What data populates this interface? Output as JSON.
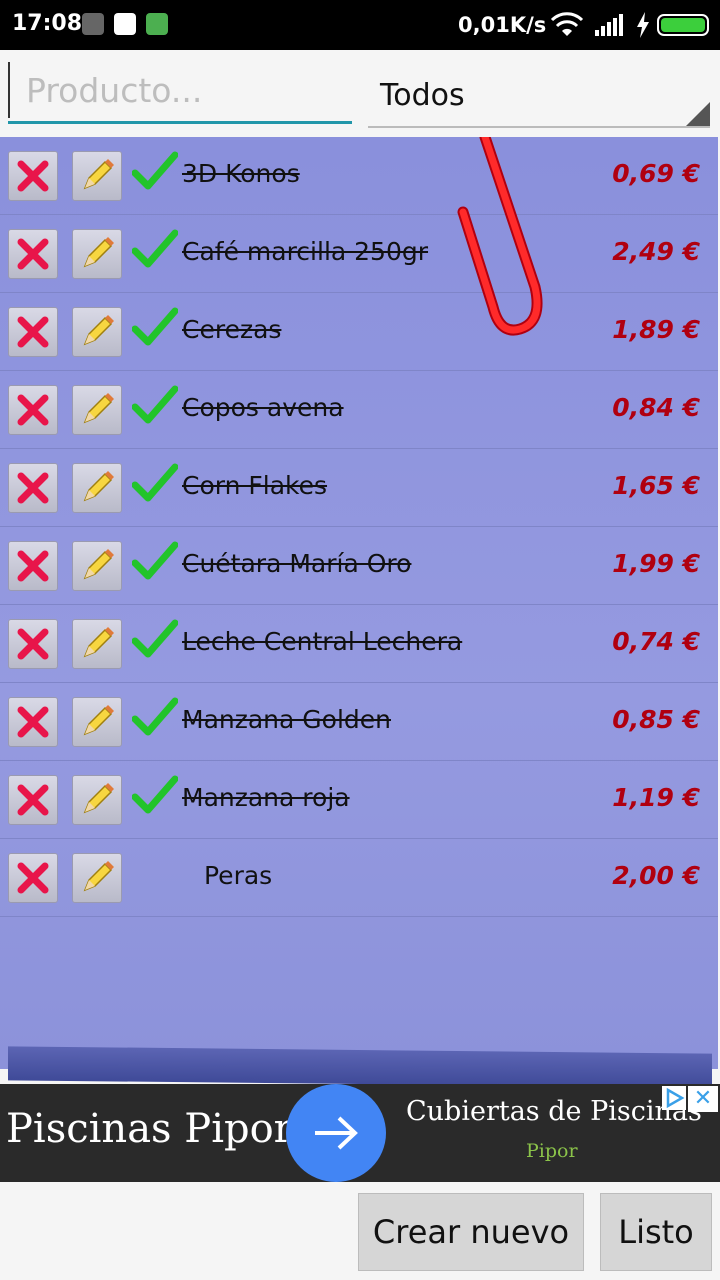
{
  "status_bar": {
    "time": "17:08",
    "network_speed": "0,01K/s",
    "icons": [
      "app-icon",
      "play-store-icon",
      "android-icon",
      "wifi-icon",
      "signal-icon",
      "charging-icon",
      "battery-icon"
    ]
  },
  "search": {
    "placeholder": "Producto..."
  },
  "filter": {
    "selected": "Todos"
  },
  "products": [
    {
      "name": "3D Konos",
      "price": "0,69 €",
      "checked": true
    },
    {
      "name": "Café marcilla 250gr",
      "price": "2,49 €",
      "checked": true
    },
    {
      "name": "Cerezas",
      "price": "1,89 €",
      "checked": true
    },
    {
      "name": "Copos avena",
      "price": "0,84 €",
      "checked": true
    },
    {
      "name": "Corn Flakes",
      "price": "1,65 €",
      "checked": true
    },
    {
      "name": "Cuétara María Oro",
      "price": "1,99 €",
      "checked": true
    },
    {
      "name": "Leche Central Lechera",
      "price": "0,74 €",
      "checked": true
    },
    {
      "name": "Manzana Golden",
      "price": "0,85 €",
      "checked": true
    },
    {
      "name": "Manzana roja",
      "price": "1,19 €",
      "checked": true
    },
    {
      "name": "Peras",
      "price": "2,00 €",
      "checked": false
    }
  ],
  "ad": {
    "title": "Piscinas Pipor",
    "subtitle": "Cubiertas de Piscinas",
    "brand": "Pipor",
    "close": "✕"
  },
  "buttons": {
    "create_new": "Crear nuevo",
    "done": "Listo"
  },
  "colors": {
    "paper": "#8d92dc",
    "price": "#b00010",
    "accent": "#2196a9",
    "check": "#22c42a",
    "delete": "#e8154a"
  }
}
